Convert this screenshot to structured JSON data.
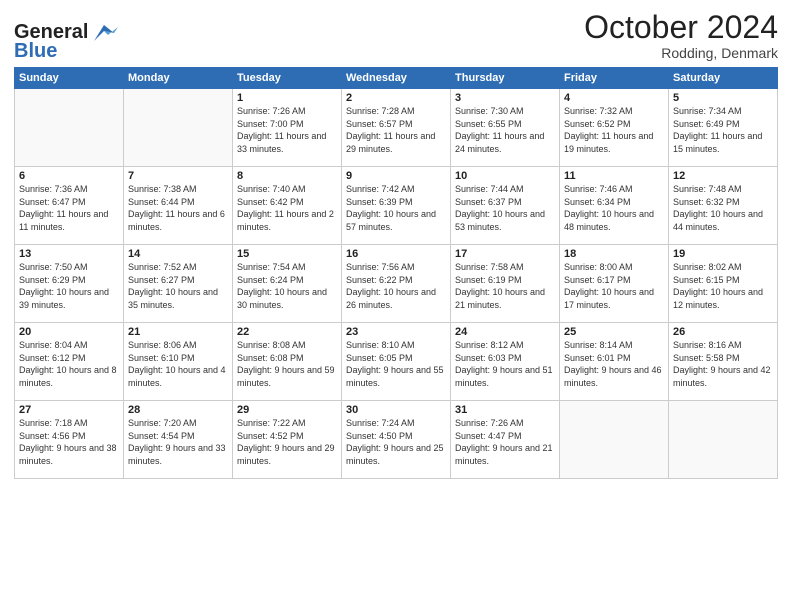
{
  "header": {
    "logo_line1": "General",
    "logo_line2": "Blue",
    "month": "October 2024",
    "location": "Rodding, Denmark"
  },
  "weekdays": [
    "Sunday",
    "Monday",
    "Tuesday",
    "Wednesday",
    "Thursday",
    "Friday",
    "Saturday"
  ],
  "weeks": [
    [
      {
        "day": "",
        "info": ""
      },
      {
        "day": "",
        "info": ""
      },
      {
        "day": "1",
        "info": "Sunrise: 7:26 AM\nSunset: 7:00 PM\nDaylight: 11 hours\nand 33 minutes."
      },
      {
        "day": "2",
        "info": "Sunrise: 7:28 AM\nSunset: 6:57 PM\nDaylight: 11 hours\nand 29 minutes."
      },
      {
        "day": "3",
        "info": "Sunrise: 7:30 AM\nSunset: 6:55 PM\nDaylight: 11 hours\nand 24 minutes."
      },
      {
        "day": "4",
        "info": "Sunrise: 7:32 AM\nSunset: 6:52 PM\nDaylight: 11 hours\nand 19 minutes."
      },
      {
        "day": "5",
        "info": "Sunrise: 7:34 AM\nSunset: 6:49 PM\nDaylight: 11 hours\nand 15 minutes."
      }
    ],
    [
      {
        "day": "6",
        "info": "Sunrise: 7:36 AM\nSunset: 6:47 PM\nDaylight: 11 hours\nand 11 minutes."
      },
      {
        "day": "7",
        "info": "Sunrise: 7:38 AM\nSunset: 6:44 PM\nDaylight: 11 hours\nand 6 minutes."
      },
      {
        "day": "8",
        "info": "Sunrise: 7:40 AM\nSunset: 6:42 PM\nDaylight: 11 hours\nand 2 minutes."
      },
      {
        "day": "9",
        "info": "Sunrise: 7:42 AM\nSunset: 6:39 PM\nDaylight: 10 hours\nand 57 minutes."
      },
      {
        "day": "10",
        "info": "Sunrise: 7:44 AM\nSunset: 6:37 PM\nDaylight: 10 hours\nand 53 minutes."
      },
      {
        "day": "11",
        "info": "Sunrise: 7:46 AM\nSunset: 6:34 PM\nDaylight: 10 hours\nand 48 minutes."
      },
      {
        "day": "12",
        "info": "Sunrise: 7:48 AM\nSunset: 6:32 PM\nDaylight: 10 hours\nand 44 minutes."
      }
    ],
    [
      {
        "day": "13",
        "info": "Sunrise: 7:50 AM\nSunset: 6:29 PM\nDaylight: 10 hours\nand 39 minutes."
      },
      {
        "day": "14",
        "info": "Sunrise: 7:52 AM\nSunset: 6:27 PM\nDaylight: 10 hours\nand 35 minutes."
      },
      {
        "day": "15",
        "info": "Sunrise: 7:54 AM\nSunset: 6:24 PM\nDaylight: 10 hours\nand 30 minutes."
      },
      {
        "day": "16",
        "info": "Sunrise: 7:56 AM\nSunset: 6:22 PM\nDaylight: 10 hours\nand 26 minutes."
      },
      {
        "day": "17",
        "info": "Sunrise: 7:58 AM\nSunset: 6:19 PM\nDaylight: 10 hours\nand 21 minutes."
      },
      {
        "day": "18",
        "info": "Sunrise: 8:00 AM\nSunset: 6:17 PM\nDaylight: 10 hours\nand 17 minutes."
      },
      {
        "day": "19",
        "info": "Sunrise: 8:02 AM\nSunset: 6:15 PM\nDaylight: 10 hours\nand 12 minutes."
      }
    ],
    [
      {
        "day": "20",
        "info": "Sunrise: 8:04 AM\nSunset: 6:12 PM\nDaylight: 10 hours\nand 8 minutes."
      },
      {
        "day": "21",
        "info": "Sunrise: 8:06 AM\nSunset: 6:10 PM\nDaylight: 10 hours\nand 4 minutes."
      },
      {
        "day": "22",
        "info": "Sunrise: 8:08 AM\nSunset: 6:08 PM\nDaylight: 9 hours\nand 59 minutes."
      },
      {
        "day": "23",
        "info": "Sunrise: 8:10 AM\nSunset: 6:05 PM\nDaylight: 9 hours\nand 55 minutes."
      },
      {
        "day": "24",
        "info": "Sunrise: 8:12 AM\nSunset: 6:03 PM\nDaylight: 9 hours\nand 51 minutes."
      },
      {
        "day": "25",
        "info": "Sunrise: 8:14 AM\nSunset: 6:01 PM\nDaylight: 9 hours\nand 46 minutes."
      },
      {
        "day": "26",
        "info": "Sunrise: 8:16 AM\nSunset: 5:58 PM\nDaylight: 9 hours\nand 42 minutes."
      }
    ],
    [
      {
        "day": "27",
        "info": "Sunrise: 7:18 AM\nSunset: 4:56 PM\nDaylight: 9 hours\nand 38 minutes."
      },
      {
        "day": "28",
        "info": "Sunrise: 7:20 AM\nSunset: 4:54 PM\nDaylight: 9 hours\nand 33 minutes."
      },
      {
        "day": "29",
        "info": "Sunrise: 7:22 AM\nSunset: 4:52 PM\nDaylight: 9 hours\nand 29 minutes."
      },
      {
        "day": "30",
        "info": "Sunrise: 7:24 AM\nSunset: 4:50 PM\nDaylight: 9 hours\nand 25 minutes."
      },
      {
        "day": "31",
        "info": "Sunrise: 7:26 AM\nSunset: 4:47 PM\nDaylight: 9 hours\nand 21 minutes."
      },
      {
        "day": "",
        "info": ""
      },
      {
        "day": "",
        "info": ""
      }
    ]
  ]
}
